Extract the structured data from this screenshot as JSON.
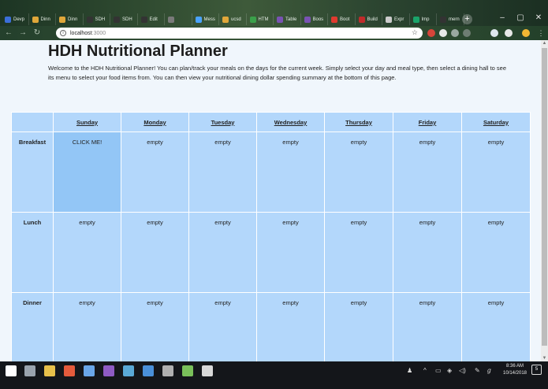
{
  "browser": {
    "tabs": [
      {
        "label": "Devp",
        "color": "#3b6fd9"
      },
      {
        "label": "Dinn",
        "color": "#e0a73a"
      },
      {
        "label": "Dinn",
        "color": "#e0a73a"
      },
      {
        "label": "SDH",
        "color": "#333333"
      },
      {
        "label": "SDH",
        "color": "#333333"
      },
      {
        "label": "Edit",
        "color": "#333333"
      },
      {
        "label": "",
        "color": "#7a7a7a"
      },
      {
        "label": "Mess",
        "color": "#4aa3ff"
      },
      {
        "label": "ucsd",
        "color": "#e0a73a"
      },
      {
        "label": "HTM",
        "color": "#3aa04a"
      },
      {
        "label": "Table",
        "color": "#7952b3"
      },
      {
        "label": "Boos",
        "color": "#7952b3"
      },
      {
        "label": "Boot",
        "color": "#e03a2f"
      },
      {
        "label": "Build",
        "color": "#c02a2a"
      },
      {
        "label": "Expr",
        "color": "#cccccc"
      },
      {
        "label": "Imp",
        "color": "#1aa36a"
      },
      {
        "label": "mern",
        "color": "#333333"
      }
    ],
    "new_tab": "+",
    "window_controls": {
      "minimize": "–",
      "maximize": "▢",
      "close": "✕"
    },
    "address": {
      "host": "localhost",
      "port": ":3000"
    }
  },
  "page": {
    "title": "HDH Nutritional Planner",
    "intro": "Welcome to the HDH Nutritional Planner! You can plan/track your meals on the days for the current week. Simply select your day and meal type, then select a dining hall to see its menu to select your food items from. You can then view your nutritional dining dollar spending summary at the bottom of this page."
  },
  "planner": {
    "days": [
      "Sunday",
      "Monday",
      "Tuesday",
      "Wednesday",
      "Thursday",
      "Friday",
      "Saturday"
    ],
    "meals": [
      {
        "name": "Breakfast",
        "cells": [
          "CLICK ME!",
          "empty",
          "empty",
          "empty",
          "empty",
          "empty",
          "empty"
        ]
      },
      {
        "name": "Lunch",
        "cells": [
          "empty",
          "empty",
          "empty",
          "empty",
          "empty",
          "empty",
          "empty"
        ]
      },
      {
        "name": "Dinner",
        "cells": [
          "empty",
          "empty",
          "empty",
          "empty",
          "empty",
          "empty",
          "empty"
        ]
      }
    ]
  },
  "taskbar": {
    "apps": [
      {
        "name": "windows-start-icon",
        "color": "#ffffff"
      },
      {
        "name": "search-icon",
        "color": "#9aa3ad"
      },
      {
        "name": "file-explorer-icon",
        "color": "#e8c04a"
      },
      {
        "name": "chrome-icon",
        "color": "#e55b3c"
      },
      {
        "name": "paint-icon",
        "color": "#6aa6e8"
      },
      {
        "name": "onenote-icon",
        "color": "#8f5bc4"
      },
      {
        "name": "feather-icon",
        "color": "#5aa9d6"
      },
      {
        "name": "store-icon",
        "color": "#4a90d9"
      },
      {
        "name": "calculator-icon",
        "color": "#b0b0b0"
      },
      {
        "name": "notes-icon",
        "color": "#7ac05a"
      },
      {
        "name": "weather-icon",
        "color": "#d8d8d8"
      }
    ],
    "time": "8:36 AM",
    "date": "10/14/2018",
    "notification_count": "5"
  }
}
